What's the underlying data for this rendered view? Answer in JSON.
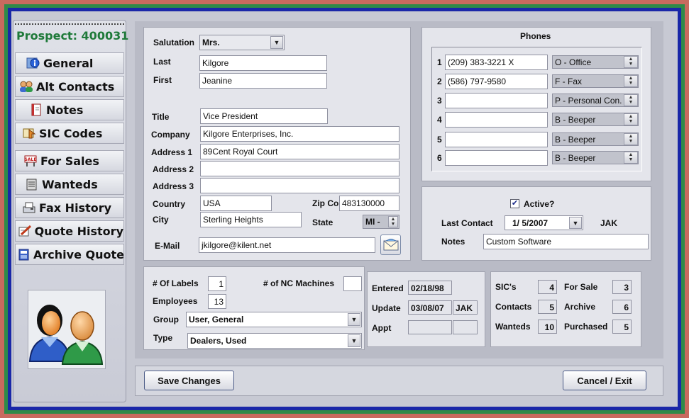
{
  "prospect": {
    "label": "Prospect:",
    "id": "400031"
  },
  "nav": [
    {
      "label": "General"
    },
    {
      "label": "Alt Contacts"
    },
    {
      "label": "Notes"
    },
    {
      "label": "SIC Codes"
    },
    {
      "label": "For Sales"
    },
    {
      "label": "Wanteds"
    },
    {
      "label": "Fax History"
    },
    {
      "label": "Quote History"
    },
    {
      "label": "Archive Quotes"
    }
  ],
  "contact": {
    "salutation_label": "Salutation",
    "salutation": "Mrs.",
    "last_label": "Last",
    "last": "Kilgore",
    "first_label": "First",
    "first": "Jeanine",
    "title_label": "Title",
    "title": "Vice President",
    "company_label": "Company",
    "company": "Kilgore Enterprises, Inc.",
    "address1_label": "Address 1",
    "address1": "89Cent Royal Court",
    "address2_label": "Address 2",
    "address2": "",
    "address3_label": "Address 3",
    "address3": "",
    "country_label": "Country",
    "country": "USA",
    "zip_label": "Zip Co",
    "zip": "483130000",
    "city_label": "City",
    "city": "Sterling Heights",
    "state_label": "State",
    "state": "MI -",
    "email_label": "E-Mail",
    "email": "jkilgore@kilent.net"
  },
  "phones": {
    "title": "Phones",
    "rows": [
      {
        "n": "1",
        "number": "(209) 383-3221 X",
        "type": "O - Office"
      },
      {
        "n": "2",
        "number": "(586) 797-9580",
        "type": "F - Fax"
      },
      {
        "n": "3",
        "number": "",
        "type": "P - Personal Con."
      },
      {
        "n": "4",
        "number": "",
        "type": "B - Beeper"
      },
      {
        "n": "5",
        "number": "",
        "type": "B - Beeper"
      },
      {
        "n": "6",
        "number": "",
        "type": "B - Beeper"
      }
    ]
  },
  "status": {
    "active_label": "Active?",
    "active_checked": "✔",
    "last_contact_label": "Last Contact",
    "last_contact": "1/  5/2007",
    "last_contact_by": "JAK",
    "notes_label": "Notes",
    "notes": "Custom Software"
  },
  "details": {
    "labels_label": "# Of Labels",
    "labels": "1",
    "nc_label": "# of NC Machines",
    "nc": "",
    "employees_label": "Employees",
    "employees": "13",
    "group_label": "Group",
    "group": "User, General",
    "type_label": "Type",
    "type": "Dealers, Used"
  },
  "dates": {
    "entered_label": "Entered",
    "entered": "02/18/98",
    "update_label": "Update",
    "update": "03/08/07",
    "update_by": "JAK",
    "appt_label": "Appt",
    "appt": "",
    "appt_by": ""
  },
  "counts": {
    "sics_label": "SIC's",
    "sics": "4",
    "forsale_label": "For Sale",
    "forsale": "3",
    "contacts_label": "Contacts",
    "contacts": "5",
    "archive_label": "Archive",
    "archive": "6",
    "wanteds_label": "Wanteds",
    "wanteds": "10",
    "purchased_label": "Purchased",
    "purchased": "5"
  },
  "buttons": {
    "save": "Save Changes",
    "cancel": "Cancel / Exit"
  },
  "icons": [
    "info-icon",
    "contacts-icon",
    "notes-icon",
    "sic-icon",
    "for-sale-icon",
    "wanteds-icon",
    "fax-icon",
    "quote-icon",
    "archive-icon",
    "email-icon",
    "people-avatar-icon"
  ]
}
